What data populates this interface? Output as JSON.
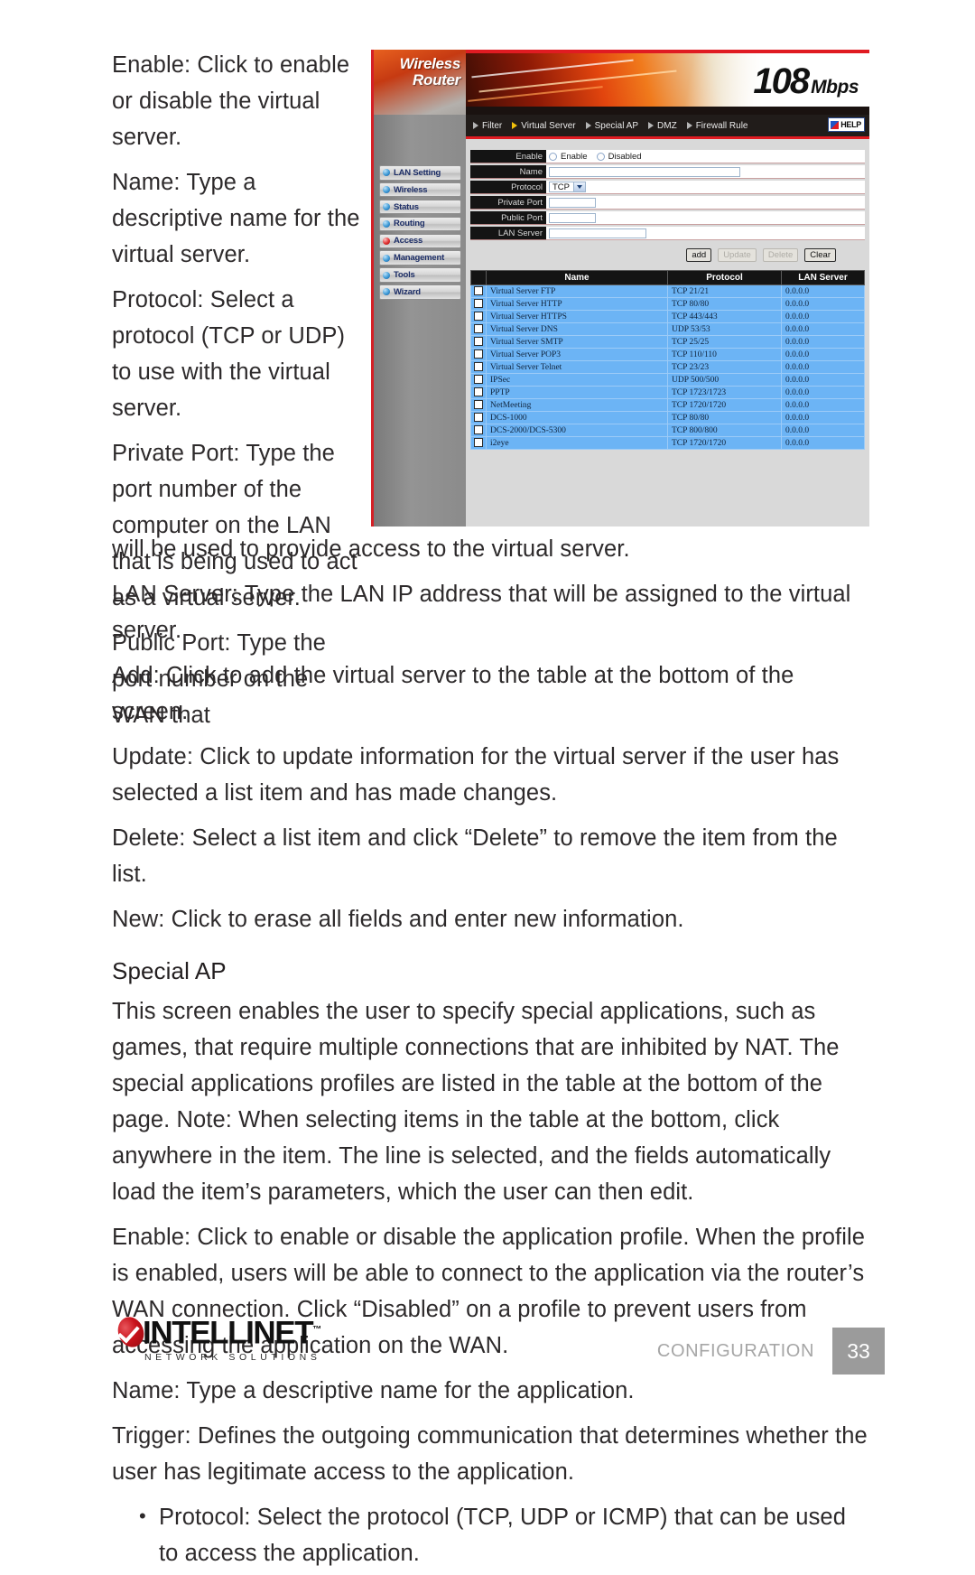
{
  "document": {
    "left_column_paragraphs": [
      "Enable: Click to enable or disable the virtual server.",
      "Name: Type a descriptive name for the virtual server.",
      "Protocol: Select a protocol (TCP or UDP) to use with the virtual server.",
      "Private Port: Type the port number of the computer on the LAN that is being used to act as a virtual server.",
      "Public Port: Type the port number on the WAN that"
    ],
    "full_width_paragraphs": [
      "will be used to provide access to the virtual server.",
      "LAN Server: Type the LAN IP address that will be assigned to the virtual server.",
      "Add: Click to add the virtual server to the table at the bottom of the screen.",
      "Update: Click to update information for the virtual server if the user has selected a list item and has made changes.",
      "Delete: Select a list item and click “Delete” to remove the item from the list.",
      "New: Click to erase all fields and enter new information."
    ],
    "special_ap": {
      "heading": "Special AP",
      "intro": "This screen enables the user to specify special applications, such as games, that require multiple connections that are inhibited by NAT. The special applications profiles are listed in the table at the bottom of the page. Note: When selecting items in the table at the bottom, click anywhere in the item. The line is selected, and the fields automatically load the item’s parameters, which the user can then edit.",
      "paragraphs": [
        "Enable: Click to enable or disable the application profile. When the profile is enabled, users will be able to connect to the application via the router’s WAN connection. Click “Disabled” on a profile to prevent users from accessing the application on the WAN.",
        "Name: Type a descriptive name for the application.",
        "Trigger: Defines the outgoing communication that determines whether the user has legitimate access to the application."
      ],
      "bullets": [
        "Protocol: Select the protocol (TCP, UDP or ICMP) that can be used to access the application."
      ]
    }
  },
  "screenshot": {
    "logo": "Wireless Router",
    "banner": {
      "speed": "108",
      "unit": "Mbps"
    },
    "navbar": {
      "items": [
        {
          "label": "Filter",
          "active": false
        },
        {
          "label": "Virtual Server",
          "active": true
        },
        {
          "label": "Special AP",
          "active": false
        },
        {
          "label": "DMZ",
          "active": false
        },
        {
          "label": "Firewall Rule",
          "active": false
        }
      ],
      "help_label": "HELP"
    },
    "sidebar": {
      "items": [
        {
          "label": "LAN Setting",
          "state": "normal"
        },
        {
          "label": "Wireless",
          "state": "normal"
        },
        {
          "label": "Status",
          "state": "normal"
        },
        {
          "label": "Routing",
          "state": "normal"
        },
        {
          "label": "Access",
          "state": "active"
        },
        {
          "label": "Management",
          "state": "normal"
        },
        {
          "label": "Tools",
          "state": "normal"
        },
        {
          "label": "Wizard",
          "state": "normal"
        }
      ]
    },
    "form": {
      "enable": {
        "label": "Enable",
        "option_enable": "Enable",
        "option_disabled": "Disabled"
      },
      "name": {
        "label": "Name",
        "value": ""
      },
      "protocol": {
        "label": "Protocol",
        "value": "TCP"
      },
      "private_port": {
        "label": "Private Port",
        "value": ""
      },
      "public_port": {
        "label": "Public Port",
        "value": ""
      },
      "lan_server": {
        "label": "LAN Server",
        "value": ""
      }
    },
    "buttons": [
      {
        "label": "add",
        "enabled": true
      },
      {
        "label": "Update",
        "enabled": false
      },
      {
        "label": "Delete",
        "enabled": false
      },
      {
        "label": "Clear",
        "enabled": true
      }
    ],
    "table": {
      "headers": [
        "",
        "Name",
        "Protocol",
        "LAN Server"
      ],
      "rows": [
        {
          "name": "Virtual Server FTP",
          "protocol": "TCP 21/21",
          "lan_server": "0.0.0.0"
        },
        {
          "name": "Virtual Server HTTP",
          "protocol": "TCP 80/80",
          "lan_server": "0.0.0.0"
        },
        {
          "name": "Virtual Server HTTPS",
          "protocol": "TCP 443/443",
          "lan_server": "0.0.0.0"
        },
        {
          "name": "Virtual Server DNS",
          "protocol": "UDP 53/53",
          "lan_server": "0.0.0.0"
        },
        {
          "name": "Virtual Server SMTP",
          "protocol": "TCP 25/25",
          "lan_server": "0.0.0.0"
        },
        {
          "name": "Virtual Server POP3",
          "protocol": "TCP 110/110",
          "lan_server": "0.0.0.0"
        },
        {
          "name": "Virtual Server Telnet",
          "protocol": "TCP 23/23",
          "lan_server": "0.0.0.0"
        },
        {
          "name": "IPSec",
          "protocol": "UDP 500/500",
          "lan_server": "0.0.0.0"
        },
        {
          "name": "PPTP",
          "protocol": "TCP 1723/1723",
          "lan_server": "0.0.0.0"
        },
        {
          "name": "NetMeeting",
          "protocol": "TCP 1720/1720",
          "lan_server": "0.0.0.0"
        },
        {
          "name": "DCS-1000",
          "protocol": "TCP 80/80",
          "lan_server": "0.0.0.0"
        },
        {
          "name": "DCS-2000/DCS-5300",
          "protocol": "TCP 800/800",
          "lan_server": "0.0.0.0"
        },
        {
          "name": "i2eye",
          "protocol": "TCP 1720/1720",
          "lan_server": "0.0.0.0"
        }
      ]
    }
  },
  "footer": {
    "brand": "INTELLINET",
    "trademark": "™",
    "tagline": "NETWORK SOLUTIONS",
    "section": "CONFIGURATION",
    "page_number": "33"
  },
  "colors": {
    "brand_red": "#c9121b",
    "accent_red": "#e01b22",
    "table_row": "#6cb4f5",
    "nav_label": "#1c2d66",
    "page_box": "#9b9b9b"
  }
}
